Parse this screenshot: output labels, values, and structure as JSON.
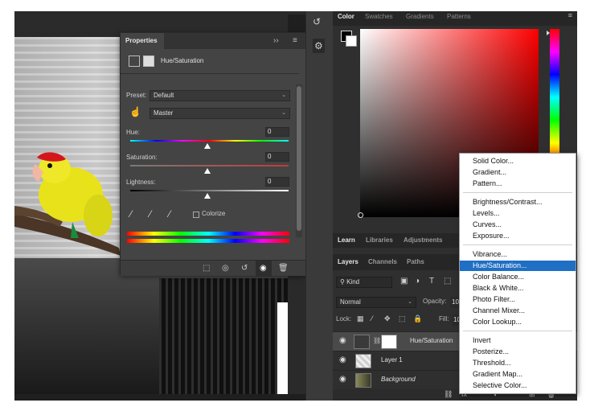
{
  "properties_panel": {
    "tab_label": "Properties",
    "adjustment_label": "Hue/Saturation",
    "preset_label": "Preset:",
    "preset_value": "Default",
    "channel_value": "Master",
    "hue_label": "Hue:",
    "hue_value": "0",
    "saturation_label": "Saturation:",
    "saturation_value": "0",
    "lightness_label": "Lightness:",
    "lightness_value": "0",
    "colorize_label": "Colorize"
  },
  "color_panel": {
    "tabs": [
      "Color",
      "Swatches",
      "Gradients",
      "Patterns"
    ],
    "foreground_color": "#000000",
    "background_color": "#ffffff"
  },
  "learn_tabs": [
    "Learn",
    "Libraries",
    "Adjustments"
  ],
  "layers_panel": {
    "tabs": [
      "Layers",
      "Channels",
      "Paths"
    ],
    "filter_kind": "Kind",
    "blend_mode": "Normal",
    "opacity_label": "Opacity:",
    "opacity_value": "10",
    "lock_label": "Lock:",
    "fill_label": "Fill:",
    "fill_value": "10",
    "layers": [
      {
        "name": "Hue/Saturation"
      },
      {
        "name": "Layer 1"
      },
      {
        "name": "Background"
      }
    ]
  },
  "adjustment_menu": {
    "groups": [
      [
        "Solid Color...",
        "Gradient...",
        "Pattern..."
      ],
      [
        "Brightness/Contrast...",
        "Levels...",
        "Curves...",
        "Exposure..."
      ],
      [
        "Vibrance...",
        "Hue/Saturation...",
        "Color Balance...",
        "Black & White...",
        "Photo Filter...",
        "Channel Mixer...",
        "Color Lookup..."
      ],
      [
        "Invert",
        "Posterize...",
        "Threshold...",
        "Gradient Map...",
        "Selective Color..."
      ]
    ],
    "highlighted": "Hue/Saturation...",
    "highlight_color": "#1f6fc4"
  }
}
